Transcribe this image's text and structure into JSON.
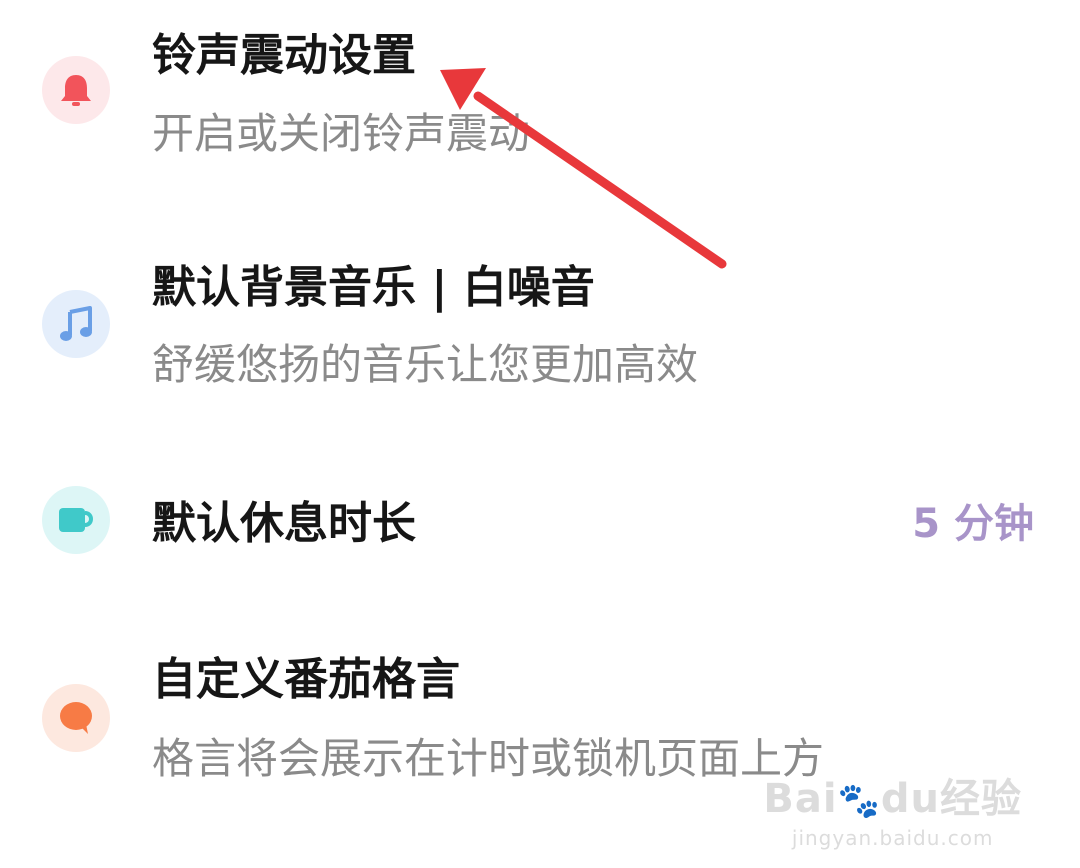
{
  "settings": {
    "ringtone": {
      "title": "铃声震动设置",
      "subtitle": "开启或关闭铃声震动",
      "icon": "bell-icon",
      "icon_bg": "#fde8ea",
      "icon_color": "#f2545b"
    },
    "music": {
      "title": "默认背景音乐 | 白噪音",
      "subtitle": "舒缓悠扬的音乐让您更加高效",
      "icon": "music-note-icon",
      "icon_bg": "#e4eefb",
      "icon_color": "#6a9fe6"
    },
    "rest": {
      "title": "默认休息时长",
      "value": "5 分钟",
      "icon": "cup-icon",
      "icon_bg": "#ddf6f6",
      "icon_color": "#40c9c9"
    },
    "motto": {
      "title": "自定义番茄格言",
      "subtitle": "格言将会展示在计时或锁机页面上方",
      "icon": "speech-bubble-icon",
      "icon_bg": "#fde8df",
      "icon_color": "#f77b45"
    }
  },
  "annotation": {
    "arrow_color": "#e8383b"
  },
  "watermark": {
    "logo_part1": "Bai",
    "logo_part2": "du",
    "logo_part3": "经验",
    "url": "jingyan.baidu.com"
  }
}
